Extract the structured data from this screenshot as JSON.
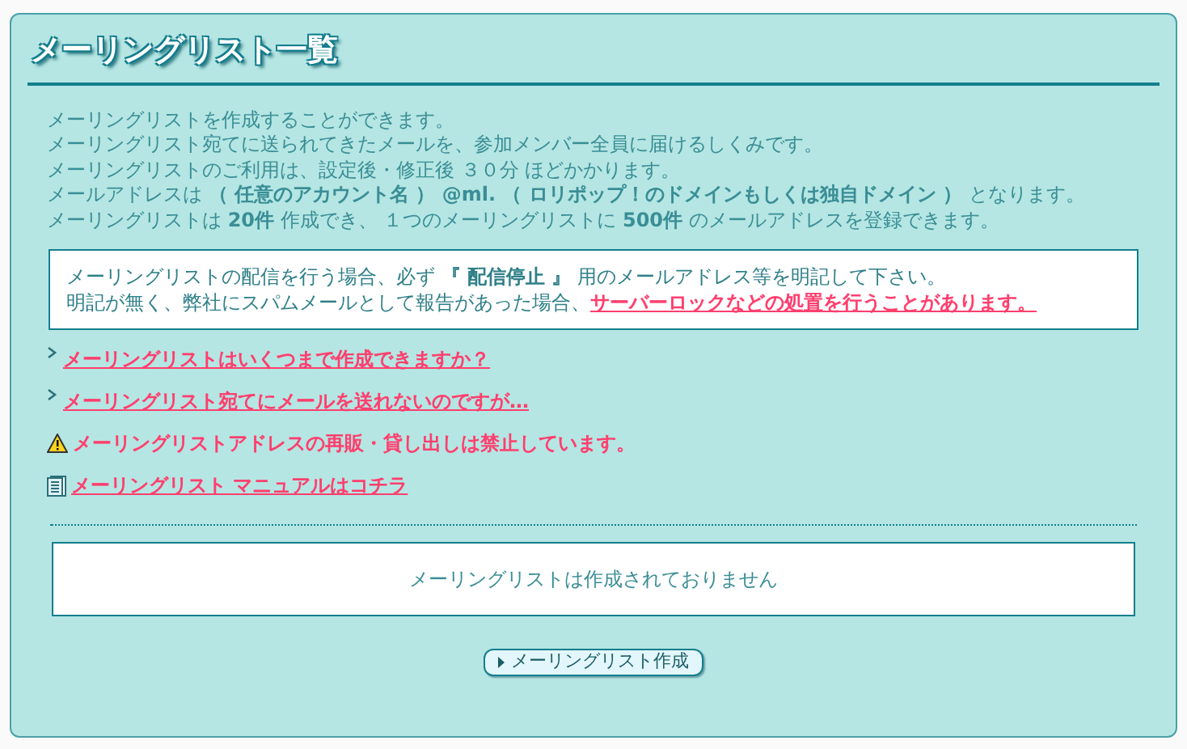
{
  "title": "メーリングリスト一覧",
  "intro": [
    "メーリングリストを作成することができます。",
    "メーリングリスト宛てに送られてきたメールを、参加メンバー全員に届けるしくみです。",
    "メーリングリストのご利用は、設定後・修正後 ３０分 ほどかかります。",
    "メールアドレスは **（ 任意のアカウント名 ） @ml. （ ロリポップ！のドメインもしくは独自ドメイン ）** となります。",
    "メーリングリストは **20件** 作成でき、 １つのメーリングリストに **500件** のメールアドレスを登録できます。"
  ],
  "notice": {
    "line1": "メーリングリストの配信を行う場合、必ず **『 配信停止 』** 用のメールアドレス等を明記して下さい。",
    "line2": "明記が無く、弊社にスパムメールとして報告があった場合、",
    "line2_link": "サーバーロックなどの処置を行うことがあります。"
  },
  "links": [
    {
      "kind": "faq",
      "text": "メーリングリストはいくつまで作成できますか？"
    },
    {
      "kind": "faq",
      "text": "メーリングリスト宛てにメールを送れないのですが…"
    },
    {
      "kind": "warning",
      "text": "メーリングリストアドレスの再販・貸し出しは禁止しています。"
    },
    {
      "kind": "manual",
      "text": "メーリングリスト マニュアルはコチラ"
    }
  ],
  "empty_message": "メーリングリストは作成されておりません",
  "create_button": "メーリングリスト作成"
}
